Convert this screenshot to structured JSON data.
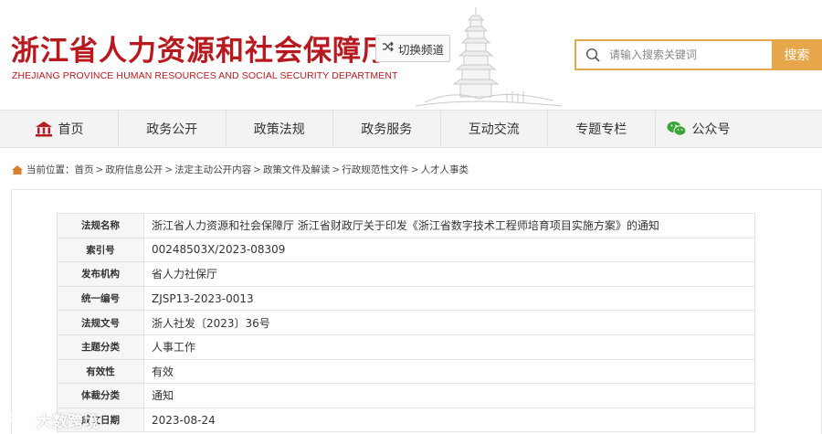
{
  "header": {
    "title": "浙江省人力资源和社会保障厅",
    "subtitle": "ZHEJIANG PROVINCE HUMAN RESOURCES AND SOCIAL SECURITY DEPARTMENT",
    "switch_label": "切换频道",
    "search_placeholder": "请输入搜索关键词",
    "search_button": "搜索",
    "brand_color": "#b8191f",
    "accent_color": "#e8a64a"
  },
  "nav": {
    "items": [
      {
        "label": "首页",
        "icon": "home-icon"
      },
      {
        "label": "政务公开"
      },
      {
        "label": "政策法规"
      },
      {
        "label": "政务服务"
      },
      {
        "label": "互动交流"
      },
      {
        "label": "专题专栏"
      },
      {
        "label": "公众号",
        "icon": "wechat-icon"
      }
    ]
  },
  "breadcrumb": {
    "prefix": "当前位置：",
    "items": [
      "首页",
      "政府信息公开",
      "法定主动公开内容",
      "政策文件及解读",
      "行政规范性文件",
      "人才人事类"
    ],
    "separator": ">"
  },
  "meta": {
    "rows": [
      {
        "key": "法规名称",
        "value": "浙江省人力资源和社会保障厅 浙江省财政厅关于印发《浙江省数字技术工程师培育项目实施方案》的通知"
      },
      {
        "key": "索引号",
        "value": "00248503X/2023-08309"
      },
      {
        "key": "发布机构",
        "value": "省人力社保厅"
      },
      {
        "key": "统一编号",
        "value": "ZJSP13-2023-0013"
      },
      {
        "key": "法规文号",
        "value": "浙人社发〔2023〕36号"
      },
      {
        "key": "主题分类",
        "value": "人事工作"
      },
      {
        "key": "有效性",
        "value": "有效"
      },
      {
        "key": "体裁分类",
        "value": "通知"
      },
      {
        "key": "成文日期",
        "value": "2023-08-24"
      }
    ]
  },
  "watermark": {
    "text": "大数跨境"
  }
}
